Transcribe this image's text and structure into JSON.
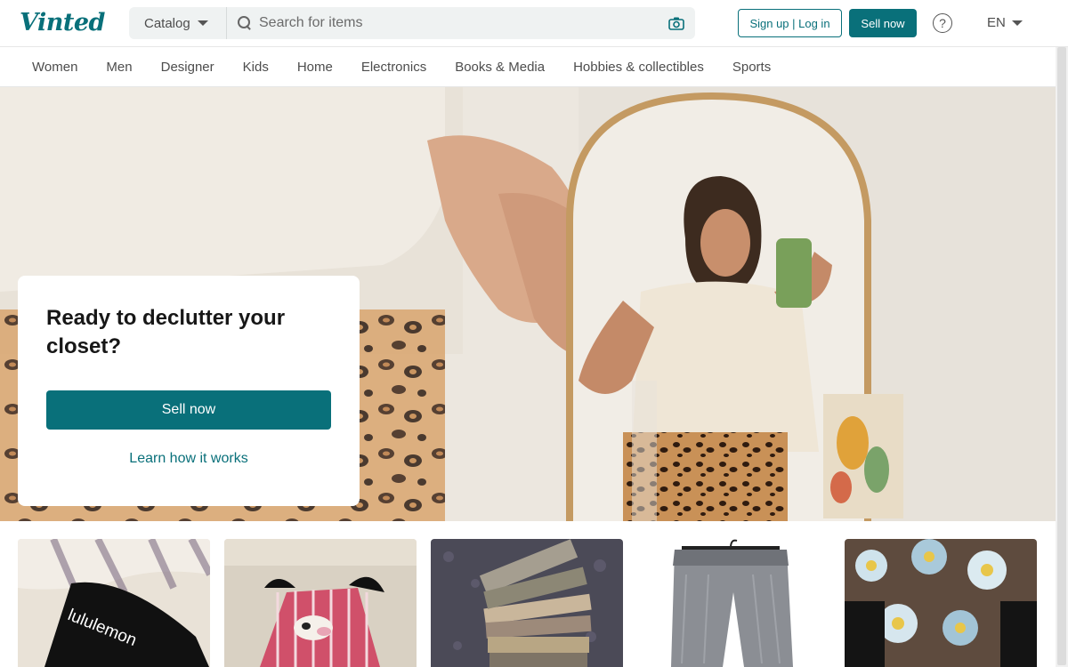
{
  "header": {
    "logo": "Vinted",
    "catalog_label": "Catalog",
    "search_placeholder": "Search for items",
    "signup_label": "Sign up | Log in",
    "sell_label": "Sell now",
    "help_glyph": "?",
    "language": "EN"
  },
  "categories": [
    "Women",
    "Men",
    "Designer",
    "Kids",
    "Home",
    "Electronics",
    "Books & Media",
    "Hobbies & collectibles",
    "Sports"
  ],
  "hero": {
    "title": "Ready to declutter your closet?",
    "sell_button": "Sell now",
    "learn_link": "Learn how it works"
  },
  "items": [
    {
      "brand_text": "lululemon"
    },
    {
      "brand_text": ""
    },
    {
      "brand_text": ""
    },
    {
      "brand_text": ""
    },
    {
      "brand_text": ""
    }
  ],
  "colors": {
    "accent": "#09707a",
    "text": "#171717",
    "muted": "#4d4d4d"
  }
}
